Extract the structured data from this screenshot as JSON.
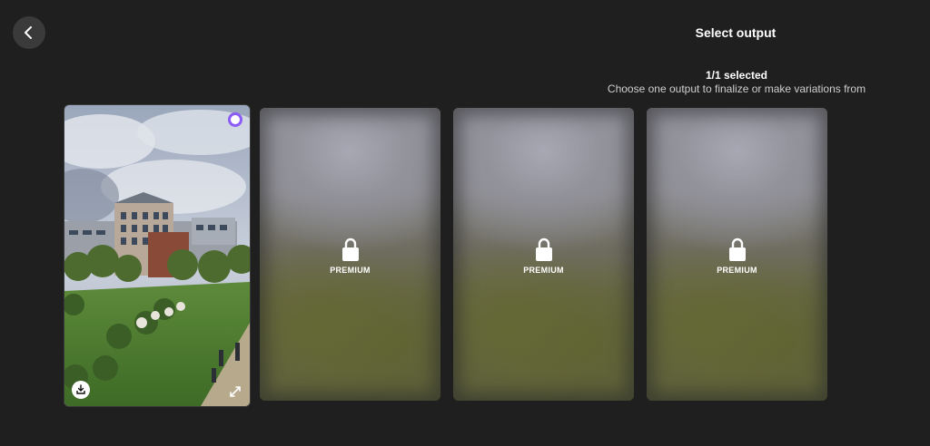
{
  "header": {
    "title": "Select output",
    "selected_count": "1/1 selected",
    "subtitle": "Choose one output to finalize or make variations from"
  },
  "outputs": [
    {
      "state": "selected",
      "icons": [
        "radio-selected-icon",
        "download-icon",
        "expand-icon"
      ]
    },
    {
      "state": "locked",
      "label": "PREMIUM",
      "icon": "lock-icon"
    },
    {
      "state": "locked",
      "label": "PREMIUM",
      "icon": "lock-icon"
    },
    {
      "state": "locked",
      "label": "PREMIUM",
      "icon": "lock-icon"
    }
  ],
  "colors": {
    "background": "#1f1f1f",
    "accent": "#8b5cf6",
    "back_button": "#3a3a3a"
  }
}
